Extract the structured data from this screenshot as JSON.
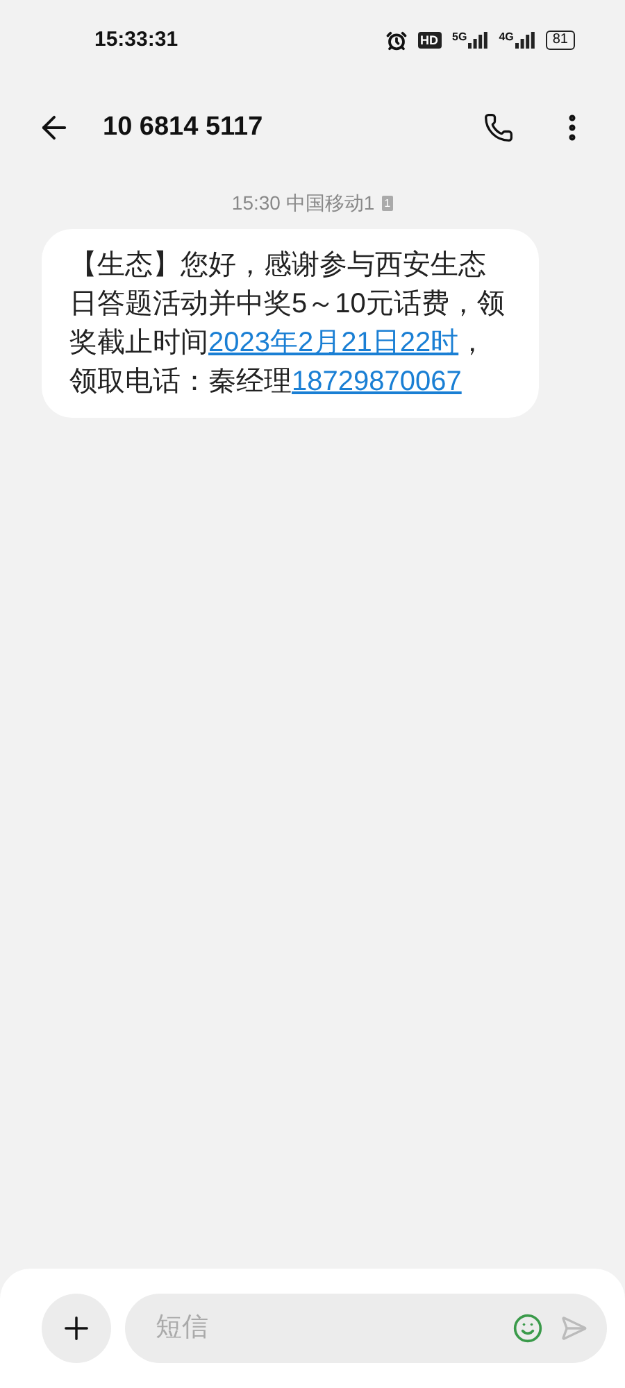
{
  "status_bar": {
    "time": "15:33:31",
    "hd": "HD",
    "network_1": "5G",
    "network_2": "4G",
    "battery": "81"
  },
  "header": {
    "title": "10 6814 5117"
  },
  "message": {
    "meta": "15:30 中国移动1",
    "sim": "1",
    "parts": [
      {
        "kind": "text",
        "text": "【生态】您好，感谢参与西安生态日答题活动并中奖5～10元话费，领奖截止时间"
      },
      {
        "kind": "link",
        "text": "2023年2月21日22时"
      },
      {
        "kind": "text",
        "text": "，领取电话：秦经理"
      },
      {
        "kind": "link",
        "text": "18729870067"
      }
    ]
  },
  "composer": {
    "placeholder": "短信"
  }
}
